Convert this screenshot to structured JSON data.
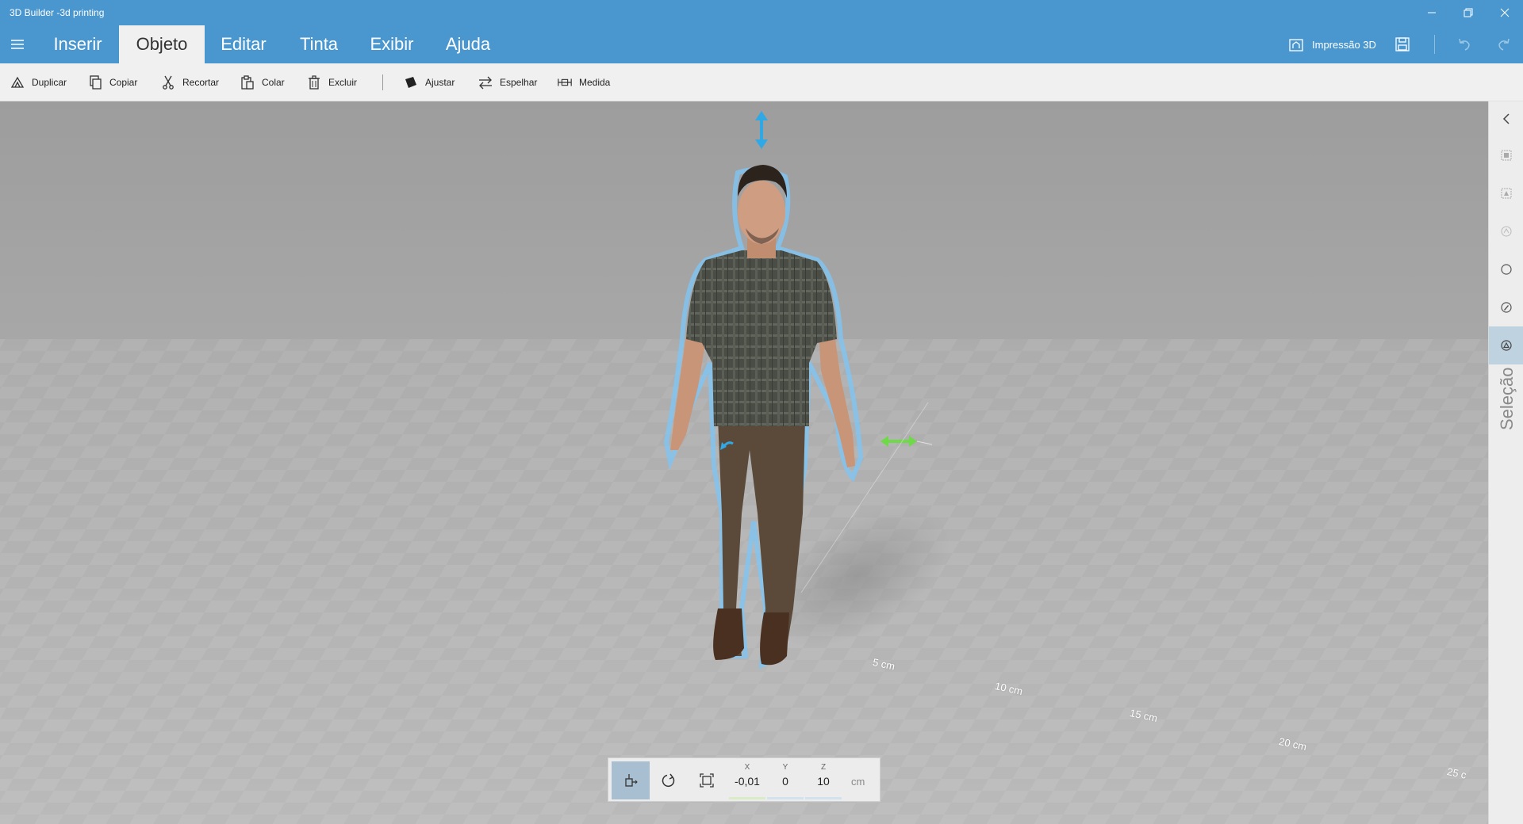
{
  "window": {
    "title": "3D Builder -3d printing"
  },
  "tabs": [
    {
      "label": "Inserir"
    },
    {
      "label": "Objeto",
      "active": true
    },
    {
      "label": "Editar"
    },
    {
      "label": "Tinta"
    },
    {
      "label": "Exibir"
    },
    {
      "label": "Ajuda"
    }
  ],
  "header": {
    "print_label": "Impressão 3D"
  },
  "toolbar": {
    "items": [
      {
        "label": "Duplicar",
        "icon": "duplicate-icon"
      },
      {
        "label": "Copiar",
        "icon": "copy-icon"
      },
      {
        "label": "Recortar",
        "icon": "cut-icon"
      },
      {
        "label": "Colar",
        "icon": "paste-icon"
      },
      {
        "label": "Excluir",
        "icon": "delete-icon"
      },
      {
        "label": "Ajustar",
        "icon": "adjust-icon"
      },
      {
        "label": "Espelhar",
        "icon": "mirror-icon"
      },
      {
        "label": "Medida",
        "icon": "measure-icon"
      }
    ]
  },
  "viewport": {
    "ruler_labels": [
      "5 cm",
      "10 cm",
      "15 cm",
      "20 cm",
      "25 c"
    ],
    "colors": {
      "floor": "#b8b8b8",
      "outline": "#7fc4f2",
      "move_z": "#31a8e6",
      "move_x": "#6fd94a"
    }
  },
  "side_panel": {
    "label": "Seleção"
  },
  "transform": {
    "x_label": "X",
    "x": "-0,01",
    "y_label": "Y",
    "y": "0",
    "z_label": "Z",
    "z": "10",
    "unit": "cm"
  }
}
